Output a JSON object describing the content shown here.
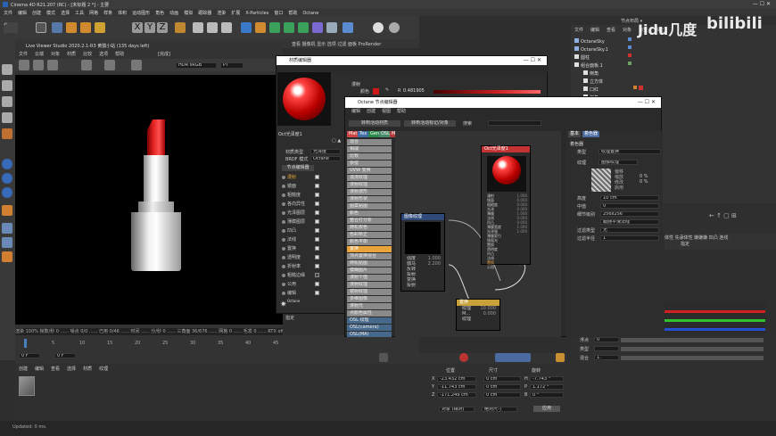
{
  "app": {
    "title": "Cinema 4D R21.207 (RC) - [未标题 2 *] - 主要"
  },
  "main_menu": [
    "文件",
    "编辑",
    "创建",
    "模式",
    "选择",
    "工具",
    "网格",
    "样条",
    "体积",
    "运动图形",
    "角色",
    "动画",
    "模拟",
    "跟踪器",
    "渲染",
    "扩展",
    "X-Particles",
    "窗口",
    "帮助",
    "Octane"
  ],
  "viewer": {
    "title": "Live Viewer Studio 2020.2.1-R3 黄猿小站 (135 days left)",
    "menu": [
      "文件",
      "云端",
      "对象",
      "材质",
      "比较",
      "选项",
      "帮助"
    ],
    "tag": "[完成]",
    "color_mode": "HDR sRGB",
    "pt": "PT",
    "status": "渲染 100% 帧数/秒 0 ...... 噪点 0/0 ...... 已用 0/46 ...... 时间 ...... 分/秒 0 ...... 三角面 36/676 ...... 网格 0 ...... 毛发 0 ...... RTX off"
  },
  "timeline": {
    "ticks": [
      "0",
      "5",
      "10",
      "15",
      "20",
      "25",
      "30",
      "35",
      "40",
      "45"
    ],
    "frame": "0 F",
    "frame2": "0 F"
  },
  "material_manager": {
    "menu": [
      "创建",
      "编辑",
      "查看",
      "选择",
      "材质",
      "纹理"
    ]
  },
  "status_bar": "Updated: 0 ms.",
  "material_editor": {
    "title": "材质编辑器",
    "name": "Oct光泽度1",
    "section": "漫射",
    "channel": "颜色",
    "r_label": "R",
    "r_value": "0.481905",
    "type_label": "材质类型",
    "type_value": "光泽度",
    "brdf_label": "BRDF 模式",
    "brdf_value": "Octane",
    "node_button": "节点编辑器",
    "channels": [
      {
        "label": "漫射",
        "on": true
      },
      {
        "label": "镜面",
        "on": true
      },
      {
        "label": "粗糙度",
        "on": true
      },
      {
        "label": "各向异性",
        "on": true
      },
      {
        "label": "光泽图层",
        "on": true
      },
      {
        "label": "薄膜图层",
        "on": true
      },
      {
        "label": "凹凸",
        "on": true
      },
      {
        "label": "法线",
        "on": true
      },
      {
        "label": "置换",
        "on": true
      },
      {
        "label": "透明度",
        "on": true
      },
      {
        "label": "折射率",
        "on": true
      },
      {
        "label": "粗糙边缘",
        "on": false
      },
      {
        "label": "公用",
        "on": true
      },
      {
        "label": "编辑",
        "on": true
      }
    ],
    "octane_label": "Octane",
    "assign_label": "指定"
  },
  "node_editor": {
    "title": "Octane 节点编辑器",
    "menu": [
      "编辑",
      "创建",
      "视图",
      "帮助"
    ],
    "buttons": [
      "转到活动材质",
      "转到活动标记/对象"
    ],
    "search_label": "搜索",
    "tabs": [
      {
        "label": "Mat",
        "color": "#c44"
      },
      {
        "label": "Tex",
        "color": "#3f6fa5"
      },
      {
        "label": "Gen",
        "color": "#2a8a4a"
      },
      {
        "label": "OSL",
        "color": "#4a8a6a"
      },
      {
        "label": "Map",
        "color": "#b03c3c"
      },
      {
        "label": "Oth",
        "color": "#2e4e7e"
      },
      {
        "label": "Emi",
        "color": "#444"
      },
      {
        "label": "Med",
        "color": "#3f7f3f"
      },
      {
        "label": "C4D",
        "color": "#3a6aa0"
      },
      {
        "label": "C4D",
        "color": "#111"
      }
    ],
    "list": [
      "混合",
      "相减",
      "比较",
      "余弦",
      "UVW 变换",
      "湍流纹理",
      "漫射纹理",
      "漫射波形",
      "漫射形状",
      "图案贴图",
      "颜色",
      "整合打分析",
      "随机校色",
      "色彩矫正",
      "颜色平衡",
      "置换",
      "顶点置换混合",
      "随机贴图",
      "模糊图片",
      "漫射个值",
      "漫射纹理",
      "镜射纹理",
      "多维图像",
      "漫射光",
      "点颜色属性",
      "OSL 纹理",
      "OSL(camera)",
      "OSL(MA)",
      "OSL(noise)"
    ],
    "list_selected": 15,
    "mat_node": {
      "title": "Oct光泽度1",
      "ports": [
        "漫射",
        "镜面",
        "粗糙度",
        "光泽",
        "薄膜",
        "法线",
        "凹凸",
        "薄膜宽度",
        "光泽强",
        "薄膜索引",
        "镜面光",
        "置换",
        "透明度",
        "凹凸",
        "法线",
        "置换",
        "公用"
      ],
      "values": [
        "1.000",
        "0.000",
        "0.000",
        "0.000",
        "1.000",
        "0.000",
        "0.000",
        "1.000",
        "1.000"
      ]
    },
    "image_node": {
      "title": "图像纹理",
      "params": [
        "强度",
        "伽马",
        "反转",
        "投射",
        "变换",
        "投射"
      ],
      "values": [
        "1.000",
        "2.200"
      ]
    },
    "displace_node": {
      "title": "置换",
      "params": [
        "纹理",
        "M...",
        "纹理"
      ],
      "values": [
        "10.000",
        "0.000"
      ]
    }
  },
  "attributes": {
    "tabs": [
      "基本",
      "着色器"
    ],
    "section": "着色器",
    "type_label": "类型",
    "type_value": "纹理置换",
    "texture_label": "纹理",
    "texture_value": "图像纹理",
    "fields": [
      {
        "label": "高度",
        "value": "10 cm"
      },
      {
        "label": "中值",
        "value": "0"
      },
      {
        "label": "细节级别",
        "value": "256x256"
      },
      {
        "label": "",
        "value": "跟随平滑法线"
      },
      {
        "label": "过滤类型",
        "value": "无"
      },
      {
        "label": "过滤半径",
        "value": "1"
      }
    ],
    "sub_labels": [
      "偏移",
      "缩放",
      "修改",
      "启用"
    ],
    "sub_values": [
      "0 %",
      "0 %"
    ],
    "bottom": [
      {
        "label": "浮点",
        "value": "0"
      },
      {
        "label": "类型",
        "value": ""
      },
      {
        "label": "混合",
        "value": "1."
      }
    ]
  },
  "object_manager": {
    "menu": [
      "文件",
      "编辑",
      "查看",
      "对象",
      "标签",
      "书签"
    ],
    "objects": [
      {
        "name": "OctaneSky",
        "color": "#8fb0e0"
      },
      {
        "name": "OctaneSky.1",
        "color": "#8fb0e0"
      },
      {
        "name": "圆柱",
        "color": "#e0e0e0"
      },
      {
        "name": "组合面板.1",
        "color": "#e0e0e0"
      },
      {
        "name": "倒角",
        "color": "#e0e0e0"
      },
      {
        "name": "立方体",
        "color": "#e0e0e0"
      },
      {
        "name": "口红",
        "color": "#e0e0e0"
      },
      {
        "name": "倒角",
        "color": "#e0e0e0"
      }
    ]
  },
  "coords": {
    "headers": [
      "位置",
      "尺寸",
      "旋转"
    ],
    "rows": [
      {
        "axis": "X",
        "pos": "-23.432 cm",
        "size": "0 cm",
        "rl": "H",
        "rot": "-7.743 °"
      },
      {
        "axis": "Y",
        "pos": "-11.743 cm",
        "size": "0 cm",
        "rl": "P",
        "rot": "1.172 °"
      },
      {
        "axis": "Z",
        "pos": "-171.249 cm",
        "size": "0 cm",
        "rl": "B",
        "rot": "0 °"
      }
    ],
    "mode": "对象 (相对)",
    "size_mode": "绝对尺寸",
    "apply": "应用"
  },
  "watermark": {
    "text": "Jidu几度"
  },
  "colors": {
    "accent_orange": "#e8a33a",
    "lipstick_red": "#d01818",
    "node_red": "#c43333",
    "node_blue": "#2e4a7a",
    "node_yellow": "#c9a13a"
  }
}
